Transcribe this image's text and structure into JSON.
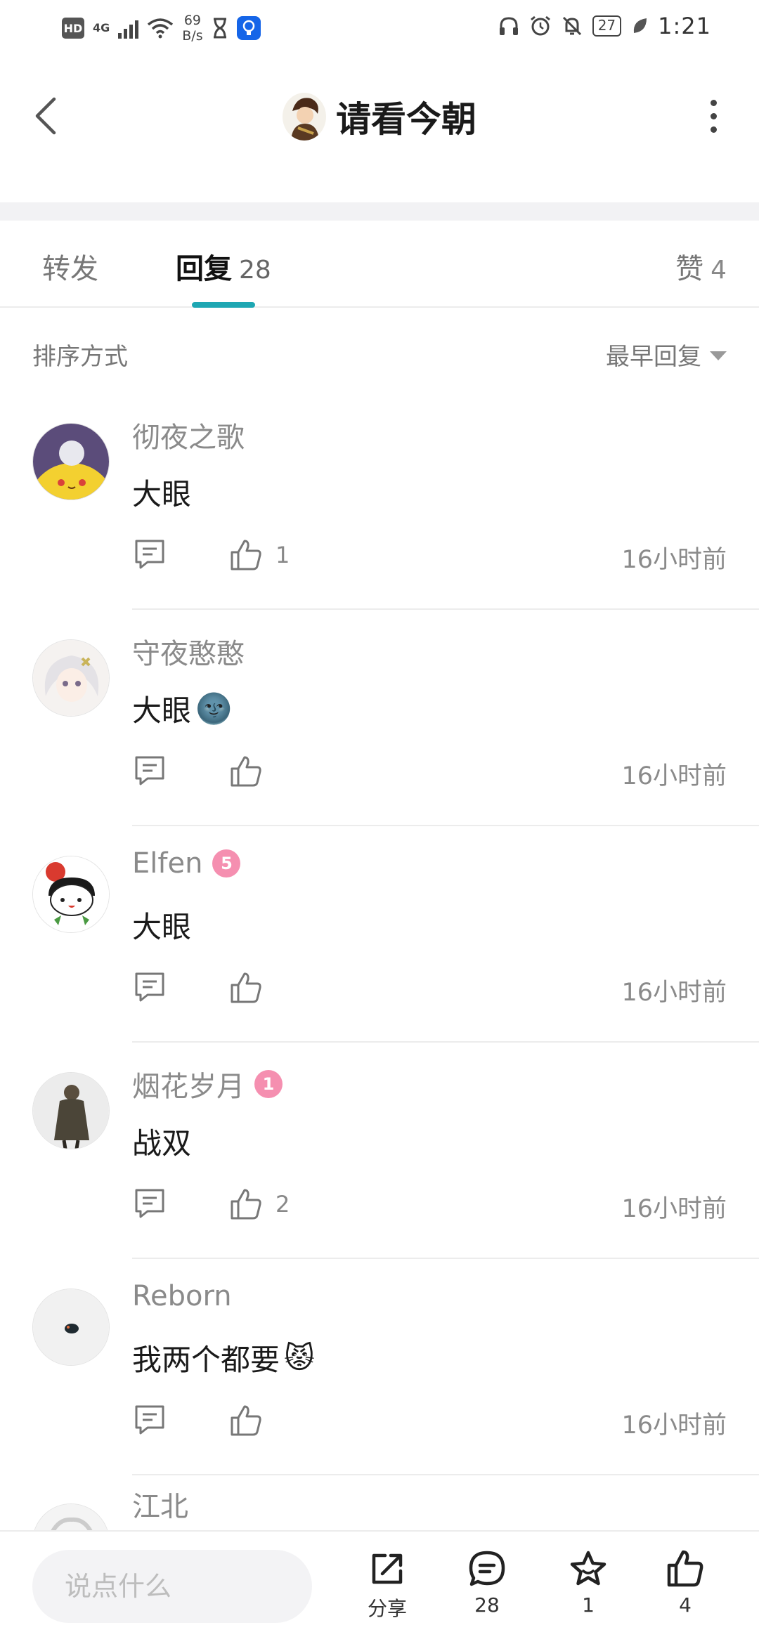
{
  "status_bar": {
    "hd": "HD",
    "network": "4G",
    "speed_value": "69",
    "speed_unit": "B/s",
    "battery": "27",
    "time": "1:21"
  },
  "header": {
    "title": "请看今朝"
  },
  "tabs": {
    "forward": {
      "label": "转发"
    },
    "reply": {
      "label": "回复",
      "count": "28"
    },
    "like": {
      "label": "赞",
      "count": "4"
    }
  },
  "sort": {
    "label": "排序方式",
    "value": "最早回复"
  },
  "comments": [
    {
      "name": "彻夜之歌",
      "text": "大眼",
      "emoji": "",
      "likes": "1",
      "time": "16小时前",
      "badge": ""
    },
    {
      "name": "守夜憨憨",
      "text": "大眼",
      "emoji": "🌚",
      "likes": "",
      "time": "16小时前",
      "badge": ""
    },
    {
      "name": "Elfen",
      "text": "大眼",
      "emoji": "",
      "likes": "",
      "time": "16小时前",
      "badge": "5"
    },
    {
      "name": "烟花岁月",
      "text": "战双",
      "emoji": "",
      "likes": "2",
      "time": "16小时前",
      "badge": "1"
    },
    {
      "name": "Reborn",
      "text": "我两个都要",
      "emoji": "😾",
      "likes": "",
      "time": "16小时前",
      "badge": ""
    }
  ],
  "partial_comment": {
    "name": "江北"
  },
  "bottom_bar": {
    "input_placeholder": "说点什么",
    "share_label": "分享",
    "comments_count": "28",
    "favorites_count": "1",
    "likes_count": "4"
  },
  "colors": {
    "accent": "#1ea7b3",
    "badge_pink": "#f58fb0",
    "muted_text": "#8a8a8a"
  }
}
